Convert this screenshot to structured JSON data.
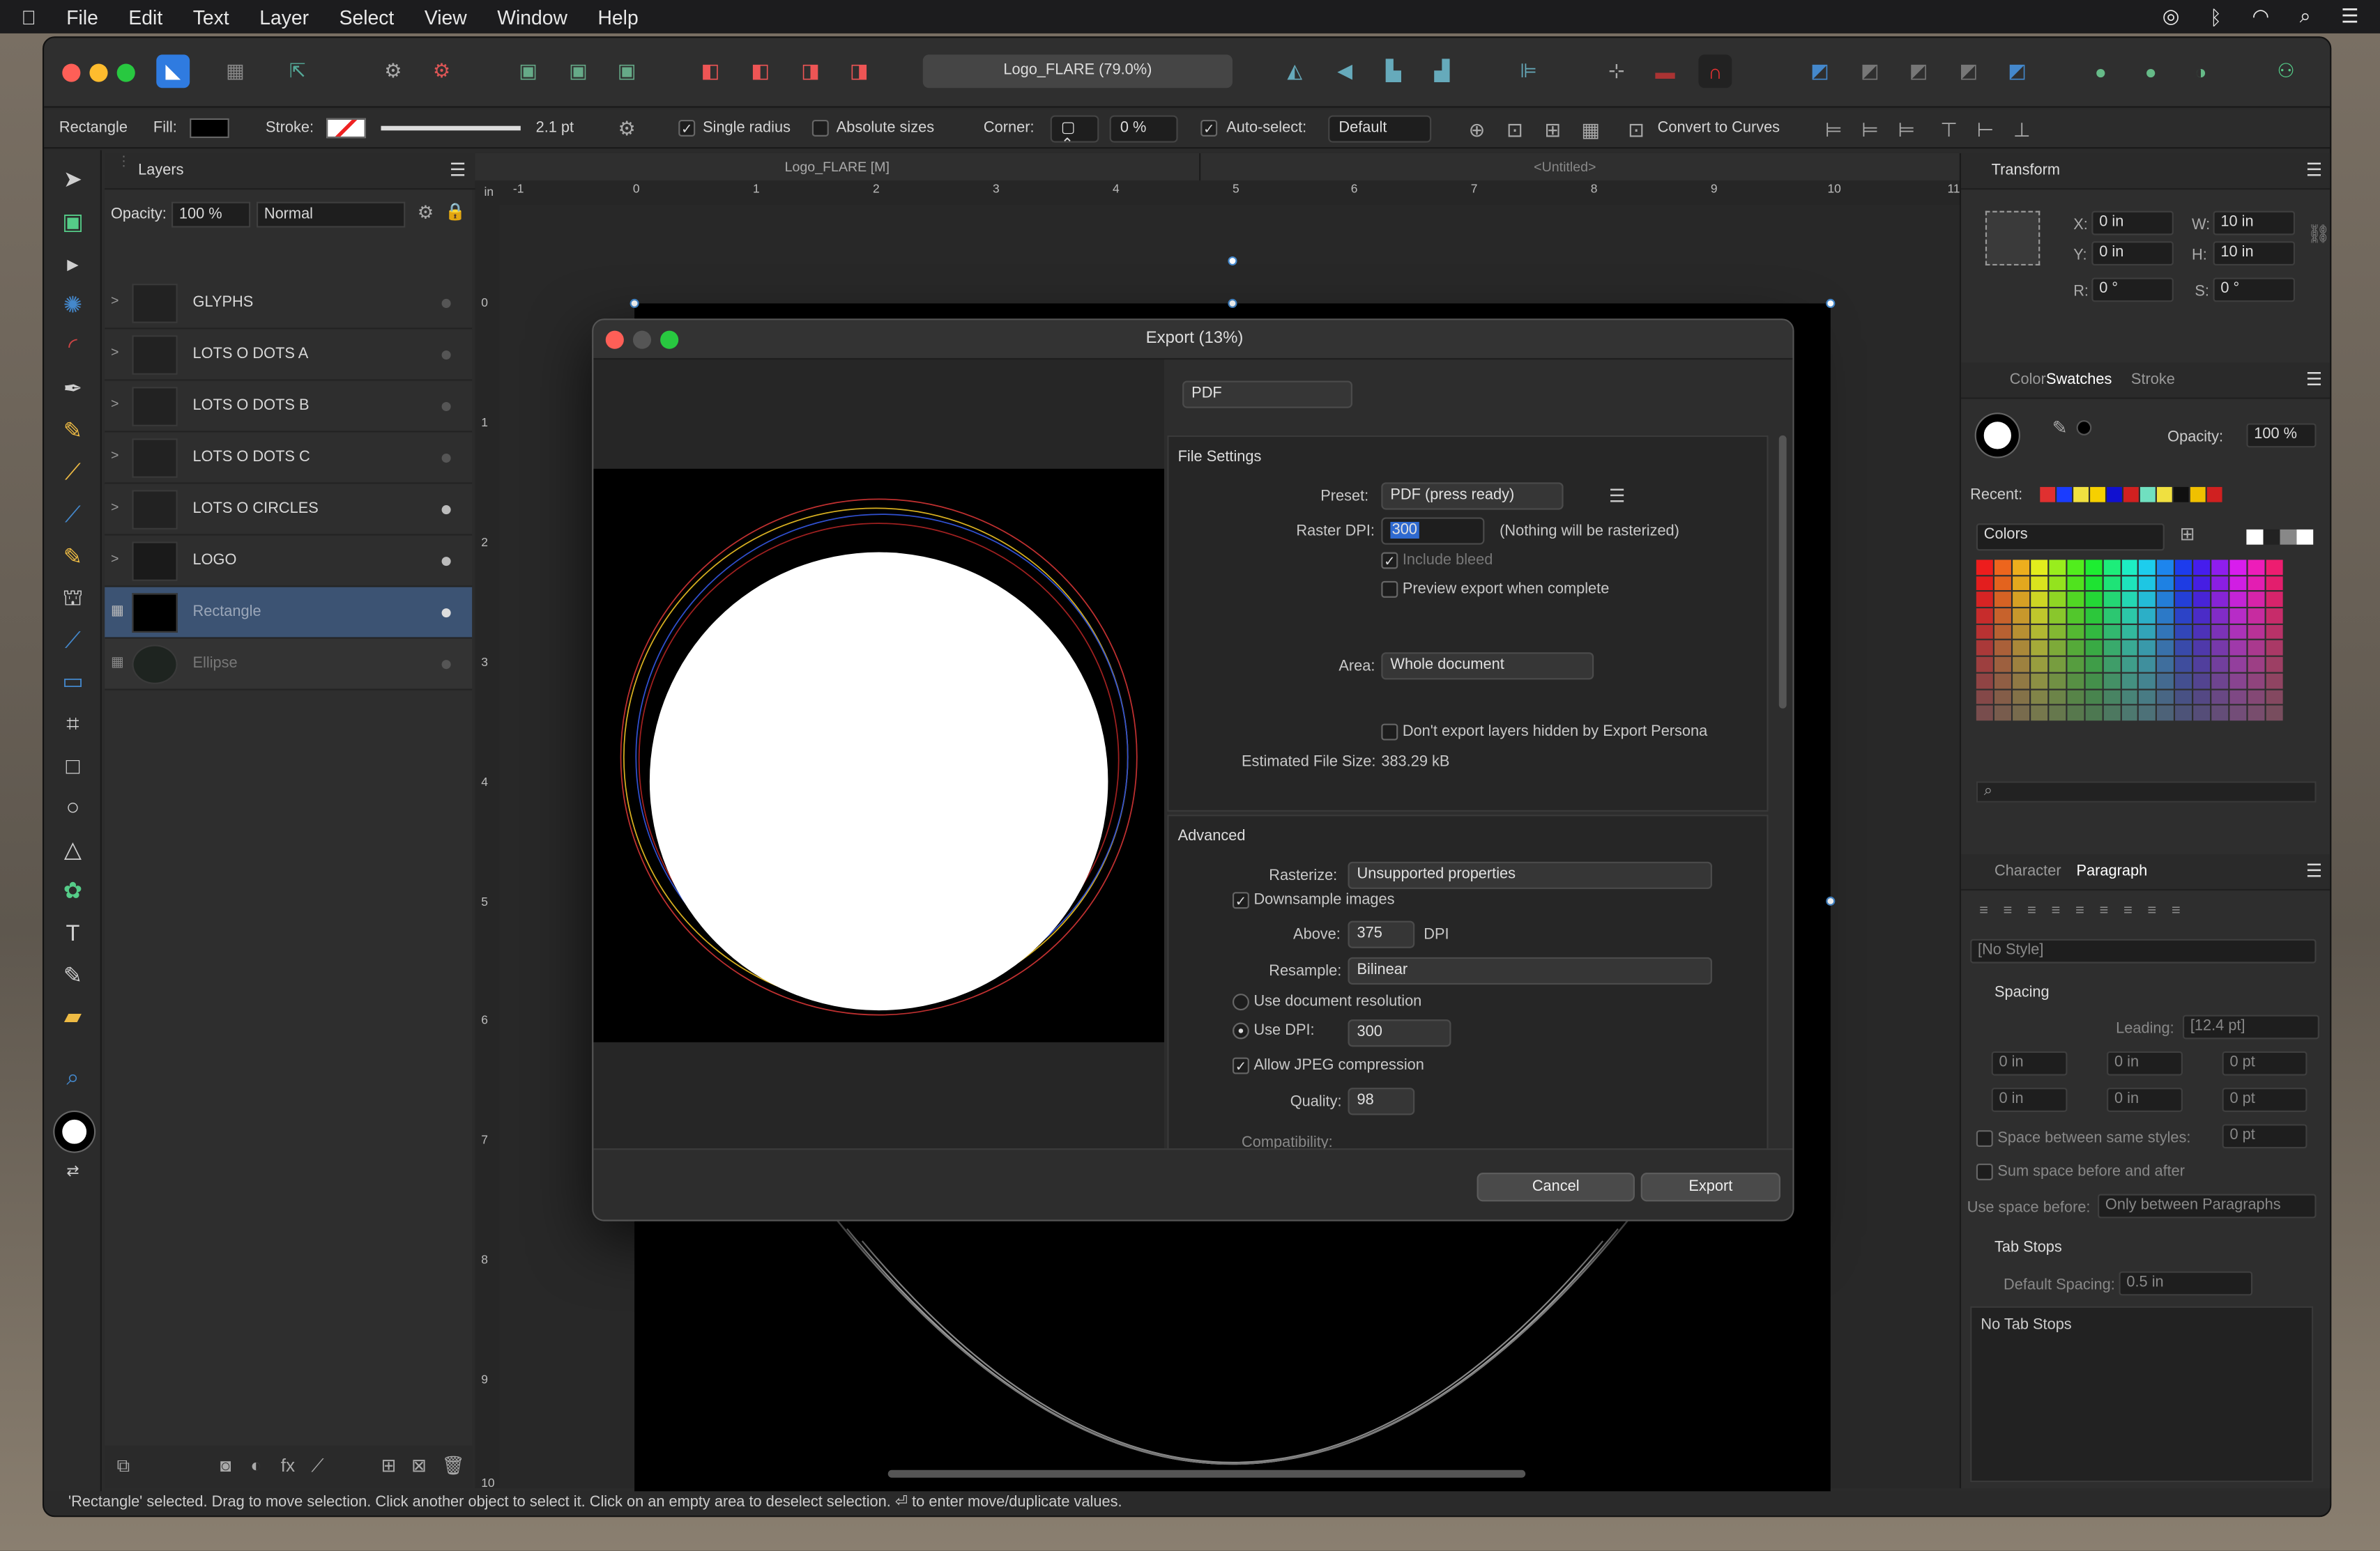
{
  "menubar": {
    "items": [
      "File",
      "Edit",
      "Text",
      "Layer",
      "Select",
      "View",
      "Window",
      "Help"
    ]
  },
  "titlebar": {
    "doc_title": "Logo_FLARE (79.0%)"
  },
  "context": {
    "tool": "Rectangle",
    "fill_label": "Fill:",
    "stroke_label": "Stroke:",
    "stroke_width": "2.1 pt",
    "single_radius": "Single radius",
    "absolute_sizes": "Absolute sizes",
    "corner_label": "Corner:",
    "corner_value": "0 %",
    "auto_select": "Auto-select:",
    "auto_select_value": "Default",
    "convert": "Convert to Curves"
  },
  "layers": {
    "title": "Layers",
    "opacity_label": "Opacity:",
    "opacity": "100 %",
    "blend": "Normal",
    "items": [
      {
        "name": "GLYPHS"
      },
      {
        "name": "LOTS O DOTS A"
      },
      {
        "name": "LOTS O DOTS B"
      },
      {
        "name": "LOTS O DOTS C"
      },
      {
        "name": "LOTS O CIRCLES"
      },
      {
        "name": "LOGO"
      },
      {
        "name": "Rectangle"
      },
      {
        "name": "Ellipse"
      }
    ]
  },
  "canvas": {
    "tab1": "Logo_FLARE [M]",
    "tab2": "<Untitled>",
    "ruler_unit": "in",
    "h_ticks": [
      "-1",
      "0",
      "1",
      "2",
      "3",
      "4",
      "5",
      "6",
      "7",
      "8",
      "9",
      "10",
      "11"
    ],
    "v_ticks": [
      "0",
      "1",
      "2",
      "3",
      "4",
      "5",
      "6",
      "7",
      "8",
      "9",
      "10"
    ]
  },
  "transform": {
    "title": "Transform",
    "x_label": "X:",
    "x": "0 in",
    "y_label": "Y:",
    "y": "0 in",
    "w_label": "W:",
    "w": "10 in",
    "h_label": "H:",
    "h": "10 in",
    "r_label": "R:",
    "r": "0 °",
    "s_label": "S:",
    "s": "0 °"
  },
  "swatches": {
    "tabs": [
      "Color",
      "Swatches",
      "Stroke"
    ],
    "opacity_label": "Opacity:",
    "opacity": "100 %",
    "recent": "Recent:",
    "palette": "Colors",
    "recent_colors": [
      "#e03030",
      "#1a3cff",
      "#f0e040",
      "#f6d000",
      "#1010d0",
      "#d02020",
      "#70e0c0",
      "#f0e040",
      "#101010",
      "#f0c000",
      "#d02020"
    ]
  },
  "paragraph": {
    "tabs": [
      "Character",
      "Paragraph"
    ],
    "style": "[No Style]",
    "spacing": "Spacing",
    "leading_label": "Leading:",
    "leading": "[12.4 pt]",
    "v1": "0 in",
    "v2": "0 in",
    "v3": "0 pt",
    "v4": "0 in",
    "v5": "0 in",
    "v6": "0 pt",
    "same_styles": "Space between same styles:",
    "same_styles_val": "0 pt",
    "sum_space": "Sum space before and after",
    "use_space": "Use space before:",
    "use_space_val": "Only between Paragraphs",
    "tab_stops": "Tab Stops",
    "default_spacing": "Default Spacing:",
    "default_spacing_val": "0.5 in",
    "no_tab_stops": "No Tab Stops"
  },
  "dialog": {
    "title": "Export (13%)",
    "format": "PDF",
    "file_settings": "File Settings",
    "preset_label": "Preset:",
    "preset": "PDF (press ready)",
    "raster_dpi_label": "Raster DPI:",
    "raster_dpi": "300",
    "raster_note": "(Nothing will be rasterized)",
    "include_bleed": "Include bleed",
    "preview": "Preview export when complete",
    "area_label": "Area:",
    "area": "Whole document",
    "dont_export": "Don't export layers hidden by Export Persona",
    "est_label": "Estimated File Size:",
    "est": "383.29 kB",
    "advanced": "Advanced",
    "rasterize_label": "Rasterize:",
    "rasterize": "Unsupported properties",
    "downsample": "Downsample images",
    "above_label": "Above:",
    "above": "375",
    "dpi": "DPI",
    "resample_label": "Resample:",
    "resample": "Bilinear",
    "use_doc_res": "Use document resolution",
    "use_dpi": "Use DPI:",
    "use_dpi_val": "300",
    "jpeg": "Allow JPEG compression",
    "quality_label": "Quality:",
    "quality": "98",
    "compat": "Compatibility:",
    "cancel": "Cancel",
    "export": "Export"
  },
  "status": {
    "text": "'Rectangle' selected. Drag to move selection. Click another object to select it. Click on an empty area to deselect selection. ⏎ to enter move/duplicate values."
  }
}
